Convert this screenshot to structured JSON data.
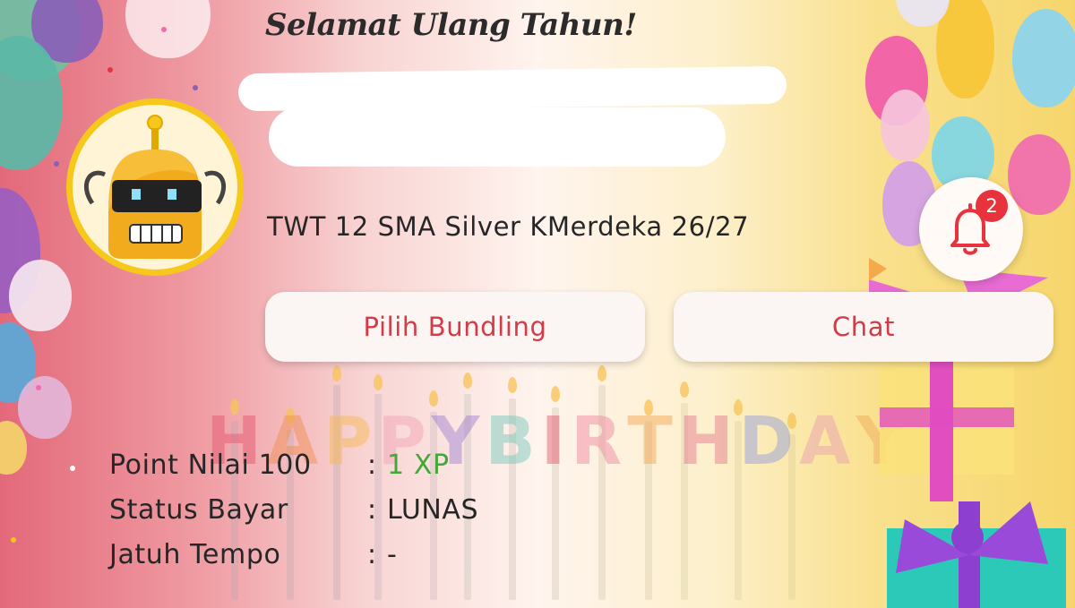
{
  "greeting": "Selamat Ulang Tahun!",
  "class_name": "TWT 12 SMA Silver KMerdeka 26/27",
  "notifications": {
    "count": "2"
  },
  "buttons": {
    "bundling": "Pilih Bundling",
    "chat": "Chat"
  },
  "info": [
    {
      "label": "Point Nilai 100",
      "value": "1 XP"
    },
    {
      "label": "Status Bayar",
      "value": "LUNAS"
    },
    {
      "label": "Jatuh Tempo",
      "value": "-"
    }
  ],
  "background_text": "HAPPY BIRTHDAY",
  "colors": {
    "accent": "#d43b49",
    "badge": "#e8323c",
    "xp": "#43a836",
    "avatar_ring": "#f6c81c"
  },
  "icons": {
    "notification": "bell-icon",
    "avatar": "robot-avatar"
  }
}
